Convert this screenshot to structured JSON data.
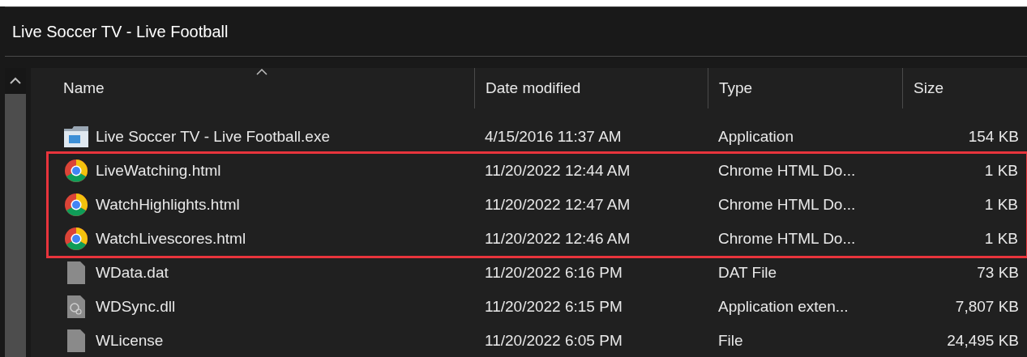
{
  "window": {
    "title": "Live Soccer TV - Live Football"
  },
  "table": {
    "columns": [
      {
        "label": "Name",
        "sorted": true
      },
      {
        "label": "Date modified",
        "sorted": false
      },
      {
        "label": "Type",
        "sorted": false
      },
      {
        "label": "Size",
        "sorted": false
      }
    ],
    "rows": [
      {
        "kind": "app",
        "name": "Live Soccer TV - Live Football.exe",
        "date": "4/15/2016 11:37 AM",
        "type": "Application",
        "size": "154 KB",
        "highlighted": false
      },
      {
        "kind": "chrome",
        "name": "LiveWatching.html",
        "date": "11/20/2022 12:44 AM",
        "type": "Chrome HTML Do...",
        "size": "1 KB",
        "highlighted": true
      },
      {
        "kind": "chrome",
        "name": "WatchHighlights.html",
        "date": "11/20/2022 12:47 AM",
        "type": "Chrome HTML Do...",
        "size": "1 KB",
        "highlighted": true
      },
      {
        "kind": "chrome",
        "name": "WatchLivescores.html",
        "date": "11/20/2022 12:46 AM",
        "type": "Chrome HTML Do...",
        "size": "1 KB",
        "highlighted": true
      },
      {
        "kind": "file",
        "name": "WData.dat",
        "date": "11/20/2022 6:16 PM",
        "type": "DAT File",
        "size": "73 KB",
        "highlighted": false
      },
      {
        "kind": "dll",
        "name": "WDSync.dll",
        "date": "11/20/2022 6:15 PM",
        "type": "Application exten...",
        "size": "7,807 KB",
        "highlighted": false
      },
      {
        "kind": "file",
        "name": "WLicense",
        "date": "11/20/2022 6:05 PM",
        "type": "File",
        "size": "24,495 KB",
        "highlighted": false
      }
    ]
  }
}
